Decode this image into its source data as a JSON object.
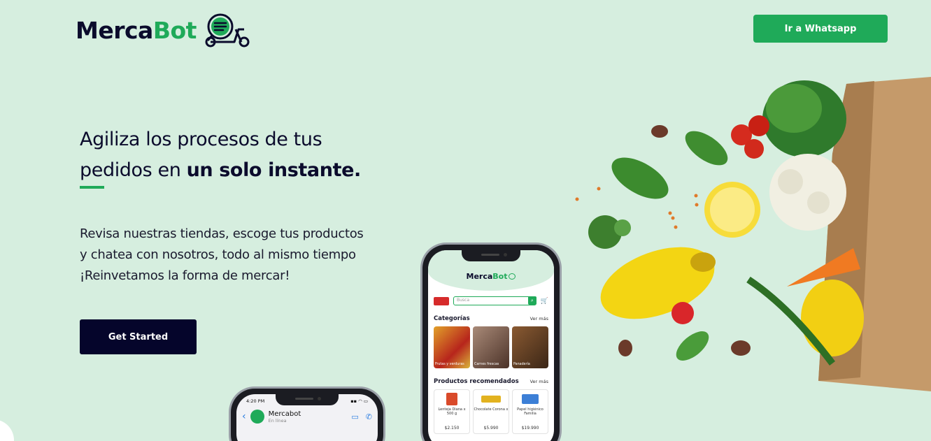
{
  "header": {
    "logo": {
      "part1": "Merca",
      "part2": "Bot"
    },
    "whatsapp_button": "Ir a Whatsapp"
  },
  "hero": {
    "title_line1": "Agiliza los procesos de tus",
    "title_line2_a": "pedidos en ",
    "title_line2_b": "un solo instante.",
    "desc_line1": "Revisa nuestras tiendas, escoge tus productos",
    "desc_line2": "y chatea con nosotros, todo al mismo tiempo",
    "desc_line3": "¡Reinvetamos la forma de mercar!",
    "cta": "Get Started"
  },
  "phone_app": {
    "logo_a": "Merca",
    "logo_b": "Bot",
    "search_placeholder": "Busca",
    "categories_title": "Categorías",
    "categories_more": "Ver más",
    "categories": [
      {
        "label": "Frutas y verduras",
        "color": "#c9502a"
      },
      {
        "label": "Carnes frescas",
        "color": "#6b4a3a"
      },
      {
        "label": "Panadería",
        "color": "#5a3b22"
      }
    ],
    "products_title": "Productos recomendados",
    "products_more": "Ver más",
    "products": [
      {
        "name": "Lenteja Diana x 500 g",
        "price": "$2.150",
        "color": "#d94a2a"
      },
      {
        "name": "Chocolate Corona x",
        "price": "$5.990",
        "color": "#e2b21f"
      },
      {
        "name": "Papel higiénico Familia",
        "price": "$19.990",
        "color": "#3c7fd6"
      }
    ]
  },
  "phone_chat": {
    "time": "4:20 PM",
    "signal": "▪▪ ◠ ▭",
    "name": "Mercabot",
    "status": "En línea"
  },
  "colors": {
    "brand_green": "#1faa59",
    "navy": "#05052b",
    "background": "#d6eedf"
  }
}
